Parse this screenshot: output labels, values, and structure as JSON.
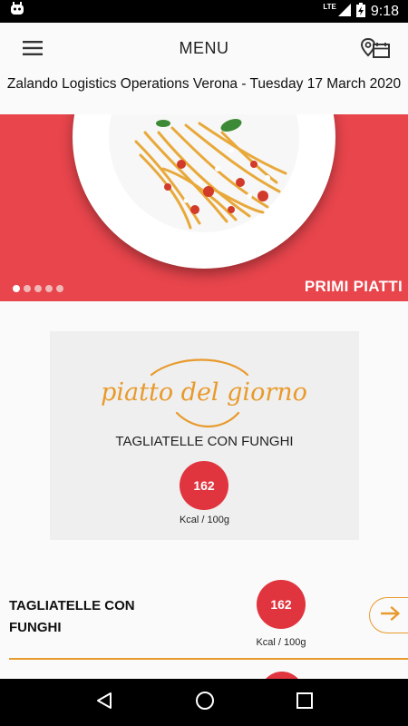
{
  "status_bar": {
    "network": "LTE",
    "time": "9:18",
    "icons": [
      "android-debug-icon",
      "signal-icon",
      "battery-icon"
    ]
  },
  "app_bar": {
    "title": "MENU",
    "left_icon": "hamburger-menu-icon",
    "right_icon": "location-calendar-icon"
  },
  "subtitle": "Zalando Logistics Operations Verona - Tuesday 17 March 2020",
  "banner": {
    "label": "PRIMI PIATTI",
    "slide_count": 5,
    "active_slide": 1,
    "background_color": "#e8454c"
  },
  "dish_of_day": {
    "logo_text": "piatto del giorno",
    "dish_name": "TAGLIATELLE CON FUNGHI",
    "kcal": "162",
    "kcal_unit": "Kcal / 100g"
  },
  "menu_items": [
    {
      "name": "TAGLIATELLE CON FUNGHI",
      "kcal": "162",
      "kcal_unit": "Kcal / 100g",
      "action_icon": "arrow-right-icon"
    }
  ],
  "colors": {
    "accent": "#e89a2c",
    "kcal_badge": "#e0343e"
  },
  "nav_bar": {
    "icons": [
      "back-icon",
      "home-icon",
      "recents-icon"
    ]
  }
}
